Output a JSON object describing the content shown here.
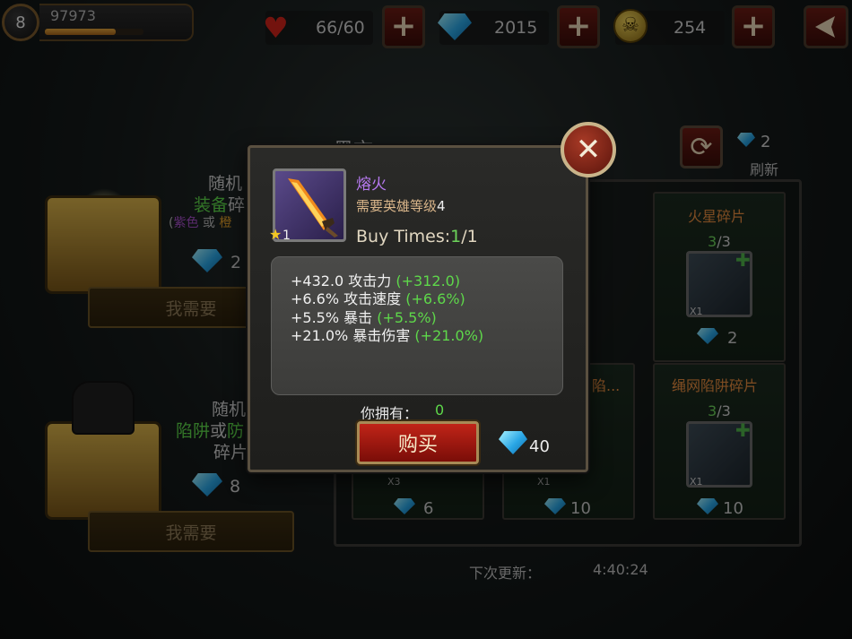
{
  "top_bar": {
    "level": "8",
    "xp": "97973",
    "xp_fill": 0.72,
    "stamina": "66/60",
    "gems": "2015",
    "skull_currency": "254"
  },
  "shop": {
    "title_partial": "黑市",
    "refresh_label": "刷新",
    "refresh_cost": "2",
    "cards": [
      {
        "title": "火星碎片",
        "count_have": "3",
        "count_total": "/3",
        "qty": "X1",
        "price": "2"
      },
      {
        "title": "陷...",
        "price": ""
      },
      {
        "title": "绳网陷阱碎片",
        "count_have": "3",
        "count_total": "/3",
        "qty": "X1",
        "price": "10"
      }
    ],
    "bottom_row": [
      {
        "qty": "X3",
        "price": "6"
      },
      {
        "qty": "X1",
        "price": "10"
      },
      {
        "qty": "X1",
        "price": "10"
      }
    ],
    "next_update_label": "下次更新：",
    "next_update_time": "4:40:24"
  },
  "left_panel": {
    "chest1": {
      "line1": "随机",
      "line2_a": "装备",
      "line2_b": "碎",
      "line3_a": "紫色",
      "line3_or": "或",
      "line3_b": "橙",
      "price": "2",
      "button": "我需要"
    },
    "chest2": {
      "line1": "随机",
      "line2_a": "陷阱",
      "line2_or": "或",
      "line2_b": "防",
      "line3": "碎片",
      "price": "8",
      "button": "我需要"
    }
  },
  "modal": {
    "item_name": "熔火",
    "req_label": "需要英雄等级",
    "req_level": "4",
    "star_count": "1",
    "buy_times_label": "Buy Times:",
    "buy_times_current": "1",
    "buy_times_total": "/1",
    "stats": [
      {
        "base": "+432.0 攻击力 ",
        "bonus": "(+312.0)"
      },
      {
        "base": "+6.6% 攻击速度 ",
        "bonus": "(+6.6%)"
      },
      {
        "base": "+5.5% 暴击 ",
        "bonus": "(+5.5%)"
      },
      {
        "base": "+21.0% 暴击伤害 ",
        "bonus": "(+21.0%)"
      }
    ],
    "own_label": "你拥有：",
    "own_value": "0",
    "buy_button": "购买",
    "price": "40",
    "close_symbol": "✕"
  }
}
